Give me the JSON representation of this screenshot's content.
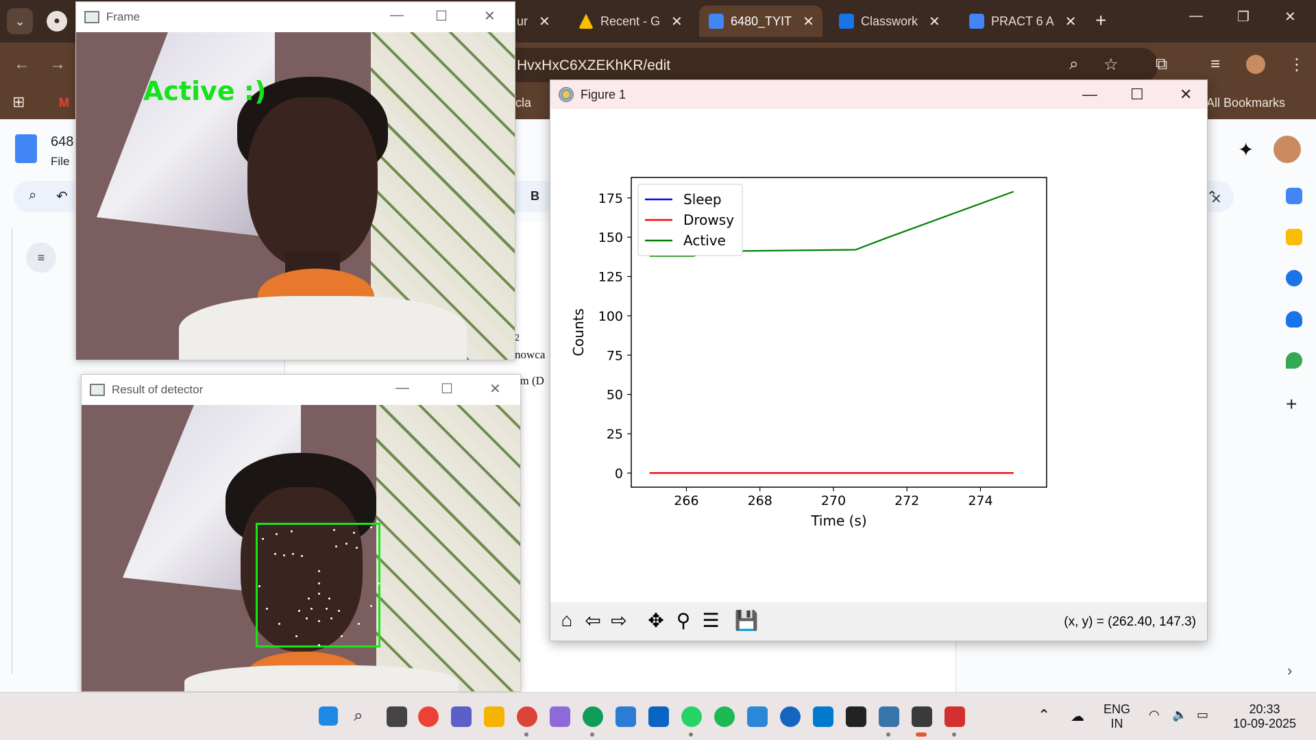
{
  "browser": {
    "tabs": [
      {
        "label": "ur",
        "color": "#1a73e8"
      },
      {
        "label": "Recent - G",
        "color": "#fbbc04"
      },
      {
        "label": "6480_TYIT",
        "color": "#4285f4"
      },
      {
        "label": "Classwork",
        "color": "#1e8e3e"
      },
      {
        "label": "PRACT 6 A",
        "color": "#4285f4"
      }
    ],
    "url": "HvxHxC6XZEKhKR/edit",
    "bookmarks": {
      "left": "cla",
      "right": "All Bookmarks"
    }
  },
  "docs": {
    "title": "648",
    "file_menu": "File",
    "bold_button": "B",
    "snippets": [
      "nowca",
      "em (D"
    ],
    "ruler_tick": "2"
  },
  "frame_window": {
    "title": "Frame",
    "overlay_text": "Active :)",
    "overlay_color": "#16e31b"
  },
  "detector_window": {
    "title": "Result of detector",
    "box_color": "#19e619"
  },
  "figure": {
    "title": "Figure 1",
    "coord_readout": "(x, y) = (262.40, 147.3)",
    "toolbar": [
      "home",
      "back",
      "forward",
      "pan",
      "zoom",
      "configure",
      "save"
    ]
  },
  "chart_data": {
    "type": "line",
    "title": "",
    "xlabel": "Time (s)",
    "ylabel": "Counts",
    "xlim": [
      264.5,
      275.8
    ],
    "ylim": [
      -9,
      188
    ],
    "xticks": [
      266,
      268,
      270,
      272,
      274
    ],
    "yticks": [
      0,
      25,
      50,
      75,
      100,
      125,
      150,
      175
    ],
    "legend": "upper-left",
    "grid": false,
    "series": [
      {
        "name": "Sleep",
        "color": "#0000ff",
        "x": [
          265.0,
          266.2,
          266.5,
          270.6,
          271.5,
          274.9
        ],
        "y": [
          0,
          0,
          0,
          0,
          0,
          0
        ]
      },
      {
        "name": "Drowsy",
        "color": "#ff0000",
        "x": [
          265.0,
          266.2,
          266.5,
          270.6,
          271.5,
          274.9
        ],
        "y": [
          0,
          0,
          0,
          0,
          0,
          0
        ]
      },
      {
        "name": "Active",
        "color": "#008000",
        "x": [
          265.0,
          266.2,
          266.5,
          270.6,
          271.5,
          274.9
        ],
        "y": [
          138,
          138,
          141,
          142,
          150,
          179
        ]
      }
    ]
  },
  "taskbar": {
    "language": "ENG",
    "region": "IN",
    "time": "20:33",
    "date": "10-09-2025"
  }
}
